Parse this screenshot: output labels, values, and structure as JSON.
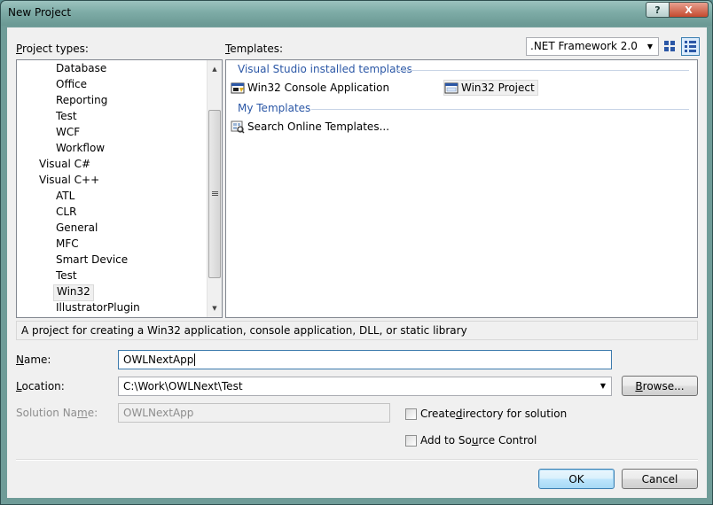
{
  "window": {
    "title": "New Project"
  },
  "titlebar": {
    "help_glyph": "?",
    "close_glyph": "X"
  },
  "project_types": {
    "label_prefix": "",
    "label_underline": "P",
    "label_rest": "roject types:",
    "items": [
      {
        "label": "Database",
        "level": 2
      },
      {
        "label": "Office",
        "level": 2
      },
      {
        "label": "Reporting",
        "level": 2
      },
      {
        "label": "Test",
        "level": 2
      },
      {
        "label": "WCF",
        "level": 2
      },
      {
        "label": "Workflow",
        "level": 2
      },
      {
        "label": "Visual C#",
        "level": 1
      },
      {
        "label": "Visual C++",
        "level": 1
      },
      {
        "label": "ATL",
        "level": 2
      },
      {
        "label": "CLR",
        "level": 2
      },
      {
        "label": "General",
        "level": 2
      },
      {
        "label": "MFC",
        "level": 2
      },
      {
        "label": "Smart Device",
        "level": 2
      },
      {
        "label": "Test",
        "level": 2
      },
      {
        "label": "Win32",
        "level": 2,
        "selected": true
      },
      {
        "label": "IllustratorPlugin",
        "level": 2
      }
    ]
  },
  "templates": {
    "label_prefix": "",
    "label_underline": "T",
    "label_rest": "emplates:",
    "framework": {
      "selected": ".NET Framework 2.0"
    },
    "groups": {
      "installed": "Visual Studio installed templates",
      "my": "My Templates"
    },
    "items": {
      "console": "Win32 Console Application",
      "project": "Win32 Project",
      "search": "Search Online Templates..."
    }
  },
  "description": "A project for creating a Win32 application, console application, DLL, or static library",
  "form": {
    "name": {
      "label_u": "N",
      "label_rest": "ame:",
      "value": "OWLNextApp"
    },
    "location": {
      "label_u": "L",
      "label_rest": "ocation:",
      "value": "C:\\Work\\OWLNext\\Test"
    },
    "solution": {
      "label_pre": "Solution Na",
      "label_u": "m",
      "label_rest": "e:",
      "value": "OWLNextApp"
    },
    "browse": {
      "label_u": "B",
      "label_rest": "rowse..."
    },
    "create_dir": {
      "pre": "Create ",
      "u": "d",
      "rest": "irectory for solution"
    },
    "source_control": {
      "pre": "Add to So",
      "u": "u",
      "rest": "rce Control"
    }
  },
  "buttons": {
    "ok": "OK",
    "cancel": "Cancel"
  },
  "colors": {
    "accent": "#2b57a6",
    "titlebar": "#7eaca7",
    "close": "#c44a2f"
  }
}
